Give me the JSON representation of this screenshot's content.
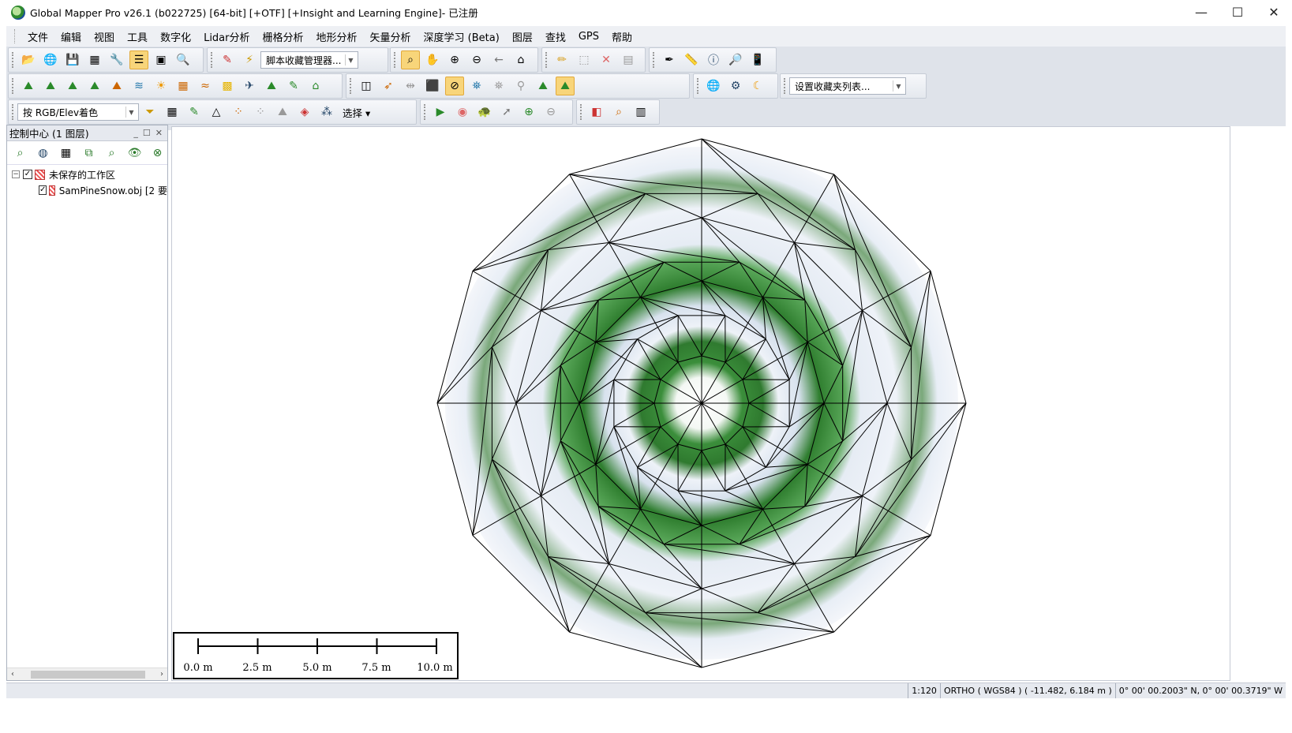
{
  "window": {
    "title": "Global Mapper Pro v26.1 (b022725) [64-bit] [+OTF] [+Insight and Learning Engine]- 已注册",
    "minimize": "—",
    "maximize": "☐",
    "close": "✕"
  },
  "menu": [
    "文件",
    "编辑",
    "视图",
    "工具",
    "数字化",
    "Lidar分析",
    "栅格分析",
    "地形分析",
    "矢量分析",
    "深度学习 (Beta)",
    "图层",
    "查找",
    "GPS",
    "帮助"
  ],
  "toolbars": {
    "script_manager": "脚本收藏管理器...",
    "favorites_list": "设置收藏夹列表...",
    "shader": "按 RGB/Elev着色",
    "select_label": "选择"
  },
  "control_center": {
    "title": "控制中心 (1 图层)",
    "tree": [
      {
        "label": "未保存的工作区"
      },
      {
        "label": "SamPineSnow.obj [2 要"
      }
    ]
  },
  "scalebar": {
    "labels": [
      "0.0 m",
      "2.5 m",
      "5.0 m",
      "7.5 m",
      "10.0 m"
    ]
  },
  "status": {
    "scale": "1:120",
    "projection": "ORTHO ( WGS84 ) ( -11.482, 6.184 m )",
    "coordinates": "0° 00' 00.2003\" N, 0° 00' 00.3719\" W"
  },
  "colors": {
    "ring_green": "#2e8b2e",
    "highlight": "#f8d57a"
  }
}
